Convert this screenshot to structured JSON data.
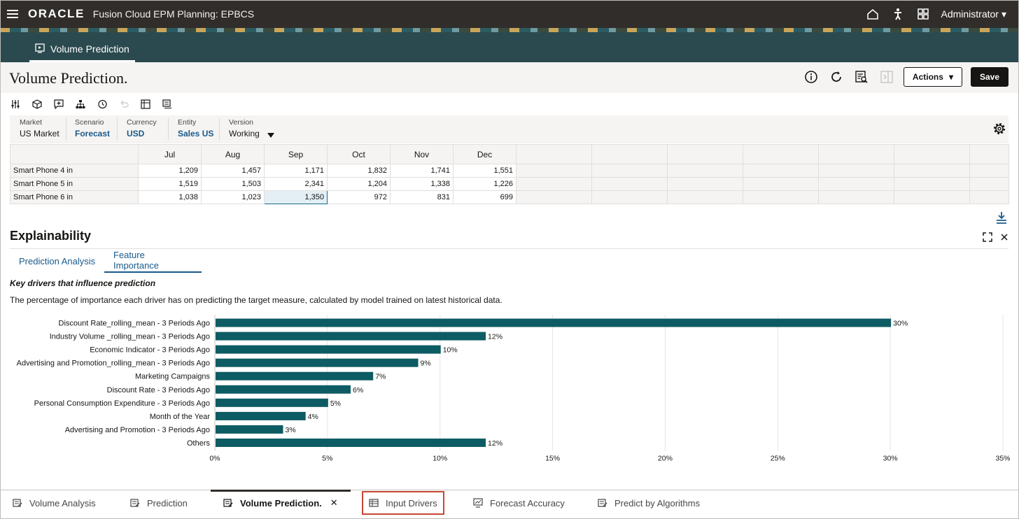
{
  "header": {
    "logo": "ORACLE",
    "app_title": "Fusion Cloud EPM Planning: EPBCS",
    "user": "Administrator"
  },
  "nav": {
    "active_tab": "Volume Prediction"
  },
  "page": {
    "title": "Volume Prediction.",
    "actions_label": "Actions",
    "save_label": "Save"
  },
  "pov": [
    {
      "label": "Market",
      "value": "US Market"
    },
    {
      "label": "Scenario",
      "value": "Forecast"
    },
    {
      "label": "Currency",
      "value": "USD"
    },
    {
      "label": "Entity",
      "value": "Sales US"
    },
    {
      "label": "Version",
      "value": "Working"
    }
  ],
  "grid": {
    "columns": [
      "Jul",
      "Aug",
      "Sep",
      "Oct",
      "Nov",
      "Dec"
    ],
    "rows": [
      {
        "label": "Smart Phone 4 in",
        "values": [
          "1,209",
          "1,457",
          "1,171",
          "1,832",
          "1,741",
          "1,551"
        ]
      },
      {
        "label": "Smart Phone 5 in",
        "values": [
          "1,519",
          "1,503",
          "2,341",
          "1,204",
          "1,338",
          "1,226"
        ]
      },
      {
        "label": "Smart Phone 6 in",
        "values": [
          "1,038",
          "1,023",
          "1,350",
          "972",
          "831",
          "699"
        ]
      }
    ]
  },
  "explainability": {
    "title": "Explainability",
    "tabs": [
      "Prediction Analysis",
      "Feature Importance"
    ],
    "active_tab": "Feature Importance",
    "subtitle": "Key drivers that influence prediction",
    "description": "The percentage of importance each driver has on predicting the target measure, calculated by model trained on latest historical data."
  },
  "chart_data": {
    "type": "bar",
    "orientation": "horizontal",
    "categories": [
      "Discount Rate_rolling_mean - 3 Periods Ago",
      "Industry Volume _rolling_mean - 3 Periods Ago",
      "Economic Indicator - 3 Periods Ago",
      "Advertising and Promotion_rolling_mean - 3 Periods Ago",
      "Marketing Campaigns",
      "Discount Rate - 3 Periods Ago",
      "Personal Consumption Expenditure - 3 Periods Ago",
      "Month of the Year",
      "Advertising and Promotion - 3 Periods Ago",
      "Others"
    ],
    "values": [
      30,
      12,
      10,
      9,
      7,
      6,
      5,
      4,
      3,
      12
    ],
    "data_labels": [
      "30%",
      "12%",
      "10%",
      "9%",
      "7%",
      "6%",
      "5%",
      "4%",
      "3%",
      "12%"
    ],
    "xlim": [
      0,
      35
    ],
    "x_ticks": [
      "0%",
      "5%",
      "10%",
      "15%",
      "20%",
      "25%",
      "30%",
      "35%"
    ],
    "bar_color": "#0e5c63",
    "grid": true
  },
  "bottom_tabs": [
    {
      "label": "Volume Analysis"
    },
    {
      "label": "Prediction"
    },
    {
      "label": "Volume Prediction."
    },
    {
      "label": "Input Drivers"
    },
    {
      "label": "Forecast Accuracy"
    },
    {
      "label": "Predict by Algorithms"
    }
  ],
  "colors": {
    "header_bg": "#312d2a",
    "nav_bg": "#2b4a4f",
    "link": "#1a5a8a",
    "highlight_border": "#c74634"
  }
}
